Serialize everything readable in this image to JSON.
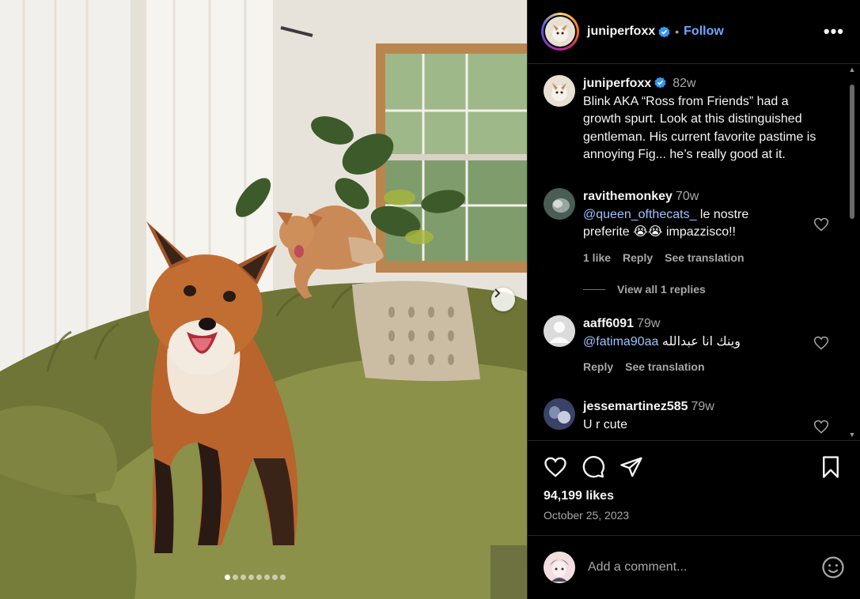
{
  "post": {
    "username": "juniperfoxx",
    "follow_label": "Follow",
    "separator": "•",
    "more_label": "•••",
    "carousel_slides": 8,
    "carousel_active_index": 0
  },
  "caption": {
    "username": "juniperfoxx",
    "time": "82w",
    "text": "Blink AKA “Ross from Friends” had a growth spurt. Look at this distinguished gentleman. His current favorite pastime is annoying Fig... he’s really good at it."
  },
  "comments": [
    {
      "username": "ravithemonkey",
      "time": "70w",
      "mention": "@queen_ofthecats_",
      "text": " le nostre preferite 😭😭 impazzisco!!",
      "likes_label": "1 like",
      "reply_label": "Reply",
      "translate_label": "See translation"
    },
    {
      "username": "aaff6091",
      "time": "79w",
      "mention": "@fatima90aa",
      "text": " وينك انا عبدالله",
      "reply_label": "Reply",
      "translate_label": "See translation"
    },
    {
      "username": "jessemartinez585",
      "time": "79w",
      "text": "U r cute"
    }
  ],
  "view_replies_label": "View all 1 replies",
  "likes_count": "94,199 likes",
  "post_date": "October 25, 2023",
  "add_comment_placeholder": "Add a comment...",
  "colors": {
    "follow": "#6fa6ff",
    "mention": "#9fc1ff",
    "verified": "#3897f0",
    "sofa": "#7a7f3f"
  }
}
